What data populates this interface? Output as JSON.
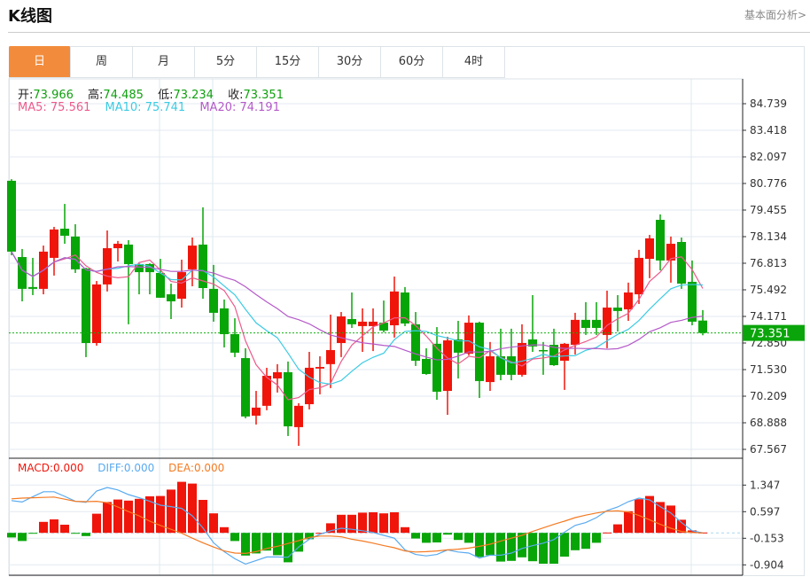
{
  "header": {
    "title": "K线图",
    "link": "基本面分析>"
  },
  "tabs": [
    {
      "label": "日",
      "active": true
    },
    {
      "label": "周"
    },
    {
      "label": "月"
    },
    {
      "label": "5分"
    },
    {
      "label": "15分"
    },
    {
      "label": "30分"
    },
    {
      "label": "60分"
    },
    {
      "label": "4时"
    }
  ],
  "ohlc_legend": {
    "open_label": "开:",
    "open": "73.966",
    "high_label": "高:",
    "high": "74.485",
    "low_label": "低:",
    "low": "73.234",
    "close_label": "收:",
    "close": "73.351"
  },
  "ma_legend": {
    "ma5": "MA5: 75.561",
    "ma10": "MA10: 75.741",
    "ma20": "MA20: 74.191"
  },
  "macd_legend": {
    "macd": "MACD:0.000",
    "diff": "DIFF:0.000",
    "dea": "DEA:0.000"
  },
  "colors": {
    "up": "#f0150a",
    "down": "#08a508",
    "ma5": "#ec5b8c",
    "ma10": "#3ccbe3",
    "ma20": "#b55ac9",
    "diff": "#58aaf0",
    "dea": "#f47a22",
    "active_tab": "#f28c3c"
  },
  "chart_data": [
    {
      "type": "candlestick",
      "price_axis_ticks": [
        "84.739",
        "83.418",
        "82.097",
        "80.776",
        "79.455",
        "78.134",
        "76.813",
        "75.492",
        "74.171",
        "72.850",
        "71.530",
        "70.209",
        "68.888",
        "67.567"
      ],
      "ylim": [
        67.567,
        84.739
      ],
      "last_price": "73.351",
      "candles_ohlc": [
        [
          80.91,
          80.99,
          77.21,
          77.39
        ],
        [
          77.12,
          77.52,
          74.92,
          75.54
        ],
        [
          75.63,
          77.08,
          75.23,
          75.54
        ],
        [
          75.54,
          77.69,
          75.27,
          77.39
        ],
        [
          77.08,
          78.62,
          76.2,
          78.49
        ],
        [
          78.53,
          79.76,
          77.78,
          78.18
        ],
        [
          78.14,
          78.75,
          76.33,
          76.51
        ],
        [
          76.55,
          76.59,
          72.15,
          72.85
        ],
        [
          72.85,
          75.93,
          72.72,
          75.76
        ],
        [
          75.76,
          78.44,
          75.41,
          77.56
        ],
        [
          77.56,
          77.92,
          76.9,
          77.78
        ],
        [
          77.74,
          77.96,
          73.78,
          76.77
        ],
        [
          76.77,
          76.81,
          75.27,
          76.37
        ],
        [
          76.77,
          76.81,
          75.27,
          76.37
        ],
        [
          76.33,
          77.03,
          75.1,
          75.1
        ],
        [
          75.27,
          75.8,
          74.04,
          74.92
        ],
        [
          75.05,
          76.99,
          74.61,
          76.37
        ],
        [
          76.51,
          78.09,
          75.67,
          77.69
        ],
        [
          77.74,
          79.59,
          75.05,
          75.58
        ],
        [
          75.54,
          76.73,
          73.91,
          74.35
        ],
        [
          74.57,
          75.01,
          72.63,
          73.29
        ],
        [
          73.29,
          74.08,
          72.15,
          72.37
        ],
        [
          72.1,
          72.59,
          69.11,
          69.2
        ],
        [
          69.24,
          70.47,
          68.8,
          69.64
        ],
        [
          69.73,
          71.62,
          69.51,
          71.22
        ],
        [
          71.09,
          71.8,
          70.39,
          71.4
        ],
        [
          71.4,
          71.93,
          68.23,
          68.71
        ],
        [
          68.67,
          69.86,
          67.74,
          69.73
        ],
        [
          69.81,
          72.41,
          69.55,
          71.62
        ],
        [
          71.58,
          72.19,
          70.3,
          71.66
        ],
        [
          71.8,
          74.26,
          70.61,
          72.5
        ],
        [
          72.85,
          74.39,
          72.15,
          74.17
        ],
        [
          74.04,
          75.36,
          73.6,
          73.78
        ],
        [
          73.69,
          74.57,
          72.41,
          73.91
        ],
        [
          73.69,
          74.57,
          72.45,
          73.91
        ],
        [
          73.86,
          74.96,
          73.38,
          73.47
        ],
        [
          73.73,
          76.15,
          73.12,
          75.41
        ],
        [
          75.36,
          75.63,
          73.69,
          73.82
        ],
        [
          73.78,
          74.39,
          71.71,
          71.97
        ],
        [
          72.06,
          72.59,
          71.27,
          71.31
        ],
        [
          72.81,
          73.64,
          70.03,
          70.43
        ],
        [
          70.47,
          73.16,
          69.28,
          72.98
        ],
        [
          73.03,
          73.95,
          71.09,
          72.37
        ],
        [
          72.32,
          74.22,
          72.23,
          73.86
        ],
        [
          73.86,
          73.91,
          70.12,
          70.96
        ],
        [
          70.91,
          72.9,
          70.47,
          72.19
        ],
        [
          72.19,
          73.56,
          71.0,
          71.27
        ],
        [
          72.19,
          73.56,
          71.0,
          71.27
        ],
        [
          71.27,
          73.78,
          71.18,
          72.85
        ],
        [
          73.03,
          75.23,
          72.41,
          72.68
        ],
        [
          72.5,
          72.9,
          71.27,
          72.45
        ],
        [
          72.76,
          73.56,
          71.71,
          71.75
        ],
        [
          71.97,
          72.85,
          70.52,
          72.81
        ],
        [
          72.76,
          74.35,
          72.28,
          74.0
        ],
        [
          74.0,
          74.88,
          73.25,
          73.6
        ],
        [
          74.0,
          74.88,
          73.25,
          73.6
        ],
        [
          73.25,
          75.45,
          72.59,
          74.61
        ],
        [
          74.61,
          75.23,
          73.42,
          74.44
        ],
        [
          74.52,
          75.85,
          73.95,
          75.36
        ],
        [
          75.27,
          77.48,
          74.79,
          77.08
        ],
        [
          77.03,
          78.22,
          76.07,
          78.05
        ],
        [
          78.97,
          79.24,
          76.46,
          76.95
        ],
        [
          76.95,
          78.14,
          75.85,
          77.78
        ],
        [
          77.87,
          78.09,
          75.54,
          75.8
        ],
        [
          75.89,
          76.95,
          73.73,
          73.91
        ],
        [
          73.966,
          74.485,
          73.234,
          73.351
        ]
      ]
    },
    {
      "type": "bar+line",
      "axis_ticks": [
        "1.347",
        "0.597",
        "-0.153",
        "-0.904"
      ],
      "ylim": [
        -1.0,
        1.6
      ],
      "macd_hist": [
        -0.13,
        -0.23,
        -0.01,
        0.31,
        0.38,
        0.23,
        -0.01,
        -0.09,
        0.54,
        0.87,
        0.94,
        0.91,
        0.96,
        1.03,
        1.04,
        1.22,
        1.44,
        1.39,
        0.93,
        0.55,
        0.16,
        -0.23,
        -0.64,
        -0.58,
        -0.5,
        -0.63,
        -0.83,
        -0.53,
        -0.18,
        0.0,
        0.27,
        0.51,
        0.51,
        0.57,
        0.58,
        0.55,
        0.58,
        0.16,
        -0.16,
        -0.28,
        -0.27,
        -0.05,
        -0.2,
        -0.28,
        -0.68,
        -0.63,
        -0.81,
        -0.79,
        -0.69,
        -0.8,
        -0.87,
        -0.87,
        -0.67,
        -0.49,
        -0.45,
        -0.28,
        0.01,
        0.24,
        0.61,
        0.95,
        1.04,
        0.87,
        0.77,
        0.37,
        0.07,
        0.01
      ],
      "diff": [
        0.91,
        0.87,
        1.02,
        1.16,
        1.16,
        1.03,
        0.89,
        0.86,
        1.18,
        1.28,
        1.21,
        1.08,
        0.99,
        0.89,
        0.78,
        0.74,
        0.69,
        0.48,
        0.14,
        -0.28,
        -0.53,
        -0.73,
        -0.88,
        -0.78,
        -0.68,
        -0.68,
        -0.69,
        -0.4,
        -0.18,
        -0.04,
        0.06,
        0.13,
        0.1,
        0.06,
        0.01,
        -0.07,
        -0.15,
        -0.48,
        -0.61,
        -0.65,
        -0.61,
        -0.48,
        -0.54,
        -0.57,
        -0.71,
        -0.63,
        -0.63,
        -0.57,
        -0.44,
        -0.36,
        -0.29,
        -0.19,
        0.02,
        0.21,
        0.29,
        0.43,
        0.63,
        0.73,
        0.88,
        0.98,
        0.93,
        0.74,
        0.56,
        0.29,
        0.06,
        0.0
      ],
      "dea": [
        0.96,
        0.98,
        0.99,
        1.0,
        1.01,
        0.95,
        0.89,
        0.88,
        0.89,
        0.85,
        0.73,
        0.6,
        0.48,
        0.33,
        0.21,
        0.1,
        -0.01,
        -0.15,
        -0.28,
        -0.4,
        -0.51,
        -0.57,
        -0.58,
        -0.53,
        -0.44,
        -0.38,
        -0.3,
        -0.22,
        -0.13,
        -0.09,
        -0.09,
        -0.11,
        -0.18,
        -0.23,
        -0.29,
        -0.36,
        -0.42,
        -0.51,
        -0.54,
        -0.53,
        -0.51,
        -0.48,
        -0.46,
        -0.43,
        -0.38,
        -0.32,
        -0.23,
        -0.15,
        -0.07,
        0.04,
        0.14,
        0.24,
        0.33,
        0.43,
        0.5,
        0.56,
        0.61,
        0.62,
        0.59,
        0.49,
        0.37,
        0.24,
        0.13,
        0.04,
        0.01,
        0.0
      ]
    }
  ]
}
